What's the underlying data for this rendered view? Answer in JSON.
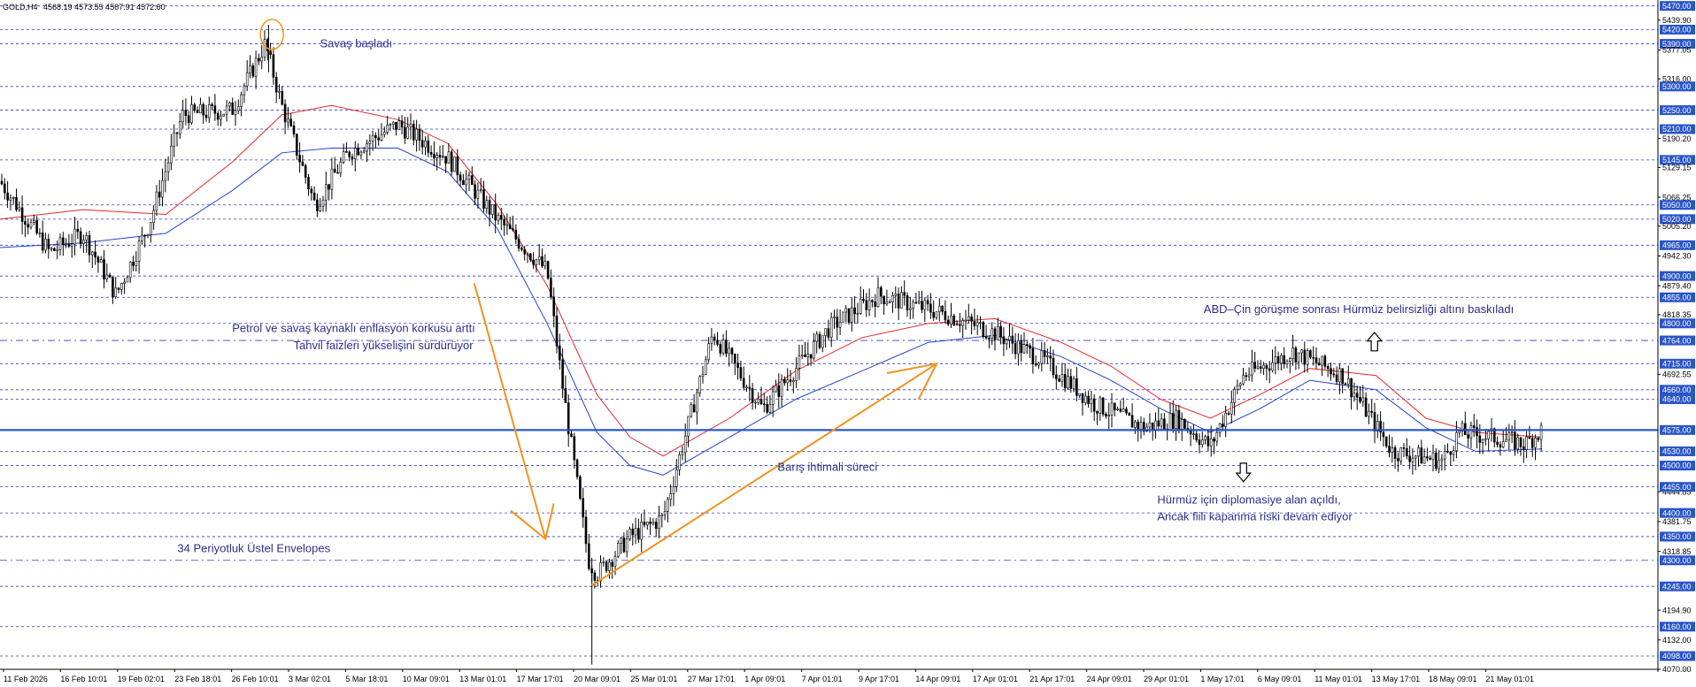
{
  "header": {
    "symbol": "GOLD,H4",
    "ohlc": "4568.19 4573.55 4567.91 4572.60"
  },
  "colors": {
    "candle": "#000000",
    "grid": "#2b3fc9",
    "ema_red": "#e8262a",
    "ema_blue": "#2540d0",
    "arrow": "#f4911e",
    "annotation": "#2b2f8a",
    "current_line": "#2255cc",
    "label_bg": "#2a55c8"
  },
  "chart_data": {
    "type": "candlestick",
    "ylim": [
      4070,
      5475
    ],
    "x_ticks": [
      "11 Feb 2026",
      "16 Feb 10:01",
      "19 Feb 02:01",
      "23 Feb 18:01",
      "26 Feb 10:01",
      "3 Mar 02:01",
      "5 Mar 18:01",
      "10 Mar 09:01",
      "13 Mar 01:01",
      "17 Mar 17:01",
      "20 Mar 09:01",
      "25 Mar 01:01",
      "27 Mar 17:01",
      "1 Apr 09:01",
      "7 Apr 01:01",
      "9 Apr 17:01",
      "14 Apr 09:01",
      "17 Apr 01:01",
      "21 Apr 17:01",
      "24 Apr 09:01",
      "29 Apr 01:01",
      "1 May 17:01",
      "6 May 09:01",
      "11 May 01:01",
      "13 May 17:01",
      "18 May 09:01",
      "21 May 01:01"
    ],
    "price_levels": [
      {
        "value": 5470.0,
        "label": "5470.00",
        "style": "dash"
      },
      {
        "value": 5439.9,
        "label": "5439.90",
        "style": "none"
      },
      {
        "value": 5420.0,
        "label": "5420.00",
        "style": "dash"
      },
      {
        "value": 5390.0,
        "label": "5390.00",
        "style": "dash"
      },
      {
        "value": 5377.05,
        "label": "5377.05",
        "style": "none"
      },
      {
        "value": 5316.0,
        "label": "5316.00",
        "style": "none"
      },
      {
        "value": 5300.0,
        "label": "5300.00",
        "style": "dash"
      },
      {
        "value": 5250.0,
        "label": "5250.00",
        "style": "dash"
      },
      {
        "value": 5210.0,
        "label": "5210.00",
        "style": "dash"
      },
      {
        "value": 5190.2,
        "label": "5190.20",
        "style": "none"
      },
      {
        "value": 5145.0,
        "label": "5145.00",
        "style": "dash"
      },
      {
        "value": 5129.15,
        "label": "5129.15",
        "style": "none"
      },
      {
        "value": 5066.25,
        "label": "5066.25",
        "style": "none"
      },
      {
        "value": 5050.0,
        "label": "5050.00",
        "style": "dash"
      },
      {
        "value": 5020.0,
        "label": "5020.00",
        "style": "dash"
      },
      {
        "value": 5005.2,
        "label": "5005.20",
        "style": "none"
      },
      {
        "value": 4965.0,
        "label": "4965.00",
        "style": "dash"
      },
      {
        "value": 4942.3,
        "label": "4942.30",
        "style": "none"
      },
      {
        "value": 4900.0,
        "label": "4900.00",
        "style": "dash"
      },
      {
        "value": 4879.4,
        "label": "4879.40",
        "style": "none"
      },
      {
        "value": 4855.0,
        "label": "4855.00",
        "style": "dash"
      },
      {
        "value": 4818.35,
        "label": "4818.35",
        "style": "none"
      },
      {
        "value": 4800.0,
        "label": "4800.00",
        "style": "dash"
      },
      {
        "value": 4764.0,
        "label": "4764.00",
        "style": "dashdot"
      },
      {
        "value": 4715.0,
        "label": "4715.00",
        "style": "dash"
      },
      {
        "value": 4692.55,
        "label": "4692.55",
        "style": "none"
      },
      {
        "value": 4660.0,
        "label": "4660.00",
        "style": "dash"
      },
      {
        "value": 4640.0,
        "label": "4640.00",
        "style": "dash"
      },
      {
        "value": 4575.0,
        "label": "4575.00",
        "style": "current"
      },
      {
        "value": 4530.0,
        "label": "4530.00",
        "style": "dash"
      },
      {
        "value": 4500.0,
        "label": "4500.00",
        "style": "dash"
      },
      {
        "value": 4444.85,
        "label": "4444.85",
        "style": "none"
      },
      {
        "value": 4455.0,
        "label": "4455.00",
        "style": "dash"
      },
      {
        "value": 4400.0,
        "label": "4400.00",
        "style": "dash"
      },
      {
        "value": 4381.75,
        "label": "4381.75",
        "style": "none"
      },
      {
        "value": 4350.0,
        "label": "4350.00",
        "style": "dash"
      },
      {
        "value": 4318.85,
        "label": "4318.85",
        "style": "none"
      },
      {
        "value": 4300.0,
        "label": "4300.00",
        "style": "dashdot"
      },
      {
        "value": 4245.0,
        "label": "4245.00",
        "style": "dash"
      },
      {
        "value": 4194.9,
        "label": "4194.90",
        "style": "none"
      },
      {
        "value": 4160.0,
        "label": "4160.00",
        "style": "dash"
      },
      {
        "value": 4132.0,
        "label": "4132.00",
        "style": "none"
      },
      {
        "value": 4098.0,
        "label": "4098.00",
        "style": "dash"
      },
      {
        "value": 4070.0,
        "label": "4070.00",
        "style": "none"
      }
    ],
    "price_path": [
      [
        0,
        5100
      ],
      [
        0.03,
        4950
      ],
      [
        0.05,
        4990
      ],
      [
        0.07,
        4860
      ],
      [
        0.09,
        5010
      ],
      [
        0.11,
        5240
      ],
      [
        0.14,
        5250
      ],
      [
        0.16,
        5390
      ],
      [
        0.17,
        5260
      ],
      [
        0.19,
        5050
      ],
      [
        0.21,
        5160
      ],
      [
        0.24,
        5220
      ],
      [
        0.27,
        5150
      ],
      [
        0.3,
        5020
      ],
      [
        0.33,
        4910
      ],
      [
        0.34,
        4650
      ],
      [
        0.355,
        4300
      ],
      [
        0.36,
        4270
      ],
      [
        0.38,
        4350
      ],
      [
        0.4,
        4390
      ],
      [
        0.43,
        4780
      ],
      [
        0.46,
        4620
      ],
      [
        0.5,
        4790
      ],
      [
        0.53,
        4860
      ],
      [
        0.57,
        4820
      ],
      [
        0.6,
        4780
      ],
      [
        0.63,
        4720
      ],
      [
        0.66,
        4630
      ],
      [
        0.69,
        4580
      ],
      [
        0.71,
        4600
      ],
      [
        0.73,
        4540
      ],
      [
        0.75,
        4690
      ],
      [
        0.78,
        4740
      ],
      [
        0.81,
        4690
      ],
      [
        0.84,
        4530
      ],
      [
        0.87,
        4510
      ],
      [
        0.88,
        4570
      ],
      [
        0.9,
        4560
      ],
      [
        0.92,
        4545
      ],
      [
        0.93,
        4575
      ]
    ],
    "ema_red": [
      [
        0,
        5020
      ],
      [
        0.05,
        5040
      ],
      [
        0.1,
        5030
      ],
      [
        0.14,
        5140
      ],
      [
        0.17,
        5240
      ],
      [
        0.2,
        5260
      ],
      [
        0.24,
        5230
      ],
      [
        0.27,
        5180
      ],
      [
        0.3,
        5050
      ],
      [
        0.33,
        4880
      ],
      [
        0.36,
        4650
      ],
      [
        0.38,
        4560
      ],
      [
        0.4,
        4520
      ],
      [
        0.44,
        4600
      ],
      [
        0.48,
        4700
      ],
      [
        0.52,
        4770
      ],
      [
        0.56,
        4800
      ],
      [
        0.6,
        4810
      ],
      [
        0.64,
        4760
      ],
      [
        0.67,
        4710
      ],
      [
        0.7,
        4640
      ],
      [
        0.73,
        4600
      ],
      [
        0.76,
        4650
      ],
      [
        0.79,
        4705
      ],
      [
        0.83,
        4690
      ],
      [
        0.86,
        4600
      ],
      [
        0.89,
        4570
      ],
      [
        0.93,
        4560
      ]
    ],
    "ema_blue": [
      [
        0,
        4960
      ],
      [
        0.05,
        4970
      ],
      [
        0.1,
        4990
      ],
      [
        0.14,
        5080
      ],
      [
        0.17,
        5160
      ],
      [
        0.2,
        5170
      ],
      [
        0.24,
        5170
      ],
      [
        0.27,
        5120
      ],
      [
        0.3,
        5000
      ],
      [
        0.33,
        4800
      ],
      [
        0.36,
        4570
      ],
      [
        0.38,
        4500
      ],
      [
        0.4,
        4480
      ],
      [
        0.44,
        4560
      ],
      [
        0.48,
        4640
      ],
      [
        0.52,
        4700
      ],
      [
        0.56,
        4760
      ],
      [
        0.6,
        4775
      ],
      [
        0.64,
        4730
      ],
      [
        0.67,
        4680
      ],
      [
        0.7,
        4620
      ],
      [
        0.73,
        4570
      ],
      [
        0.76,
        4620
      ],
      [
        0.79,
        4680
      ],
      [
        0.83,
        4660
      ],
      [
        0.86,
        4580
      ],
      [
        0.89,
        4530
      ],
      [
        0.93,
        4535
      ]
    ],
    "current_price": 4575.0,
    "annotations": [
      {
        "text": "Savaş başladı",
        "x": 0.193,
        "y": 5383
      },
      {
        "text": "Petrol ve savaş kaynaklı enflasyon korkusu arttı",
        "x": 0.14,
        "y": 4782
      },
      {
        "text": "Tahvil faizleri yükselişini sürdürüyor",
        "x": 0.177,
        "y": 4745
      },
      {
        "text": "Barış ihtimali süreci",
        "x": 0.469,
        "y": 4489
      },
      {
        "text": "34 Periyotluk Üstel Envelopes",
        "x": 0.107,
        "y": 4317
      },
      {
        "text": "ABD–Çin görüşme sonrası Hürmüz belirsizliği altını baskıladı",
        "x": 0.726,
        "y": 4822
      },
      {
        "text": "Hürmüz için diplomasiye alan açıldı,",
        "x": 0.698,
        "y": 4420
      },
      {
        "text": "Ancak fiili kapanma riski devam ediyor",
        "x": 0.698,
        "y": 4384
      }
    ]
  }
}
